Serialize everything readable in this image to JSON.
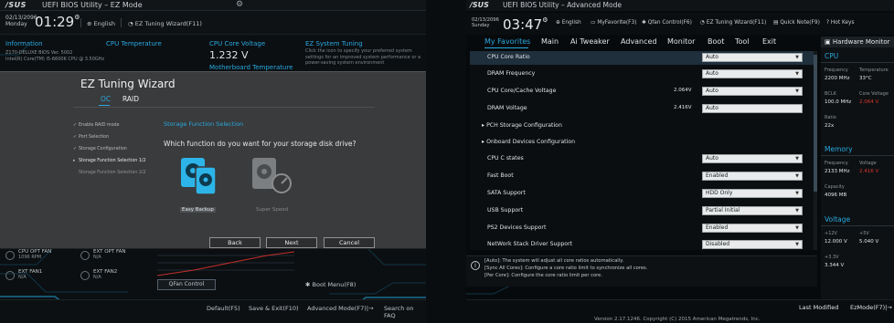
{
  "ez": {
    "logo": "/SUS",
    "title": "UEFI BIOS Utility – EZ Mode",
    "date": "02/13/2096",
    "day": "Monday",
    "time": "01:29",
    "language": "English",
    "wizard_link": "EZ Tuning Wizard(F11)",
    "info_head": "Information",
    "cpu_temp_head": "CPU Temperature",
    "cpu_volt_head": "CPU Core Voltage",
    "cpu_volt_value": "1.232 V",
    "ez_system_tuning_head": "EZ System Tuning",
    "ez_system_tuning_text": "Click the icon to specify your preferred system settings for an improved system performance or a power-saving system environment",
    "mb_temp_head": "Motherboard Temperature",
    "info_lines": [
      "Z170-DELUXE   BIOS Ver. 5002",
      "Intel(R) Core(TM) i5-6600K CPU @ 3.50GHz"
    ],
    "fans": [
      {
        "name": "CPU OPT FAN",
        "value": "1096 RPM"
      },
      {
        "name": "EXT FAN1",
        "value": "N/A"
      },
      {
        "name": "EXT OPT FAN",
        "value": "N/A"
      },
      {
        "name": "EXT FAN2",
        "value": "N/A"
      }
    ],
    "qfan_button": "QFan Control",
    "boot_menu": "Boot Menu(F8)",
    "bottom": [
      "Default(F5)",
      "Save & Exit(F10)",
      "Advanced Mode(F7)|→",
      "Search on FAQ"
    ]
  },
  "wizard": {
    "title": "EZ Tuning Wizard",
    "tabs": [
      "OC",
      "RAID"
    ],
    "steps": [
      "Enable RAID mode",
      "Port Selection",
      "Storage Configuration",
      "Storage Function Selection 1/2",
      "Storage Function Selection 2/2"
    ],
    "section_title": "Storage Function Selection",
    "question": "Which function do you want for your storage disk drive?",
    "options": [
      "Easy Backup",
      "Super Speed"
    ],
    "buttons": [
      "Back",
      "Next",
      "Cancel"
    ]
  },
  "adv": {
    "logo": "/SUS",
    "title": "UEFI BIOS Utility – Advanced Mode",
    "date": "02/13/2096",
    "day": "Sunday",
    "time": "03:47",
    "top_items": [
      "English",
      "MyFavorite(F3)",
      "Qfan Control(F6)",
      "EZ Tuning Wizard(F11)",
      "Quick Note(F9)",
      "Hot Keys"
    ],
    "menu": [
      "My Favorites",
      "Main",
      "Ai Tweaker",
      "Advanced",
      "Monitor",
      "Boot",
      "Tool",
      "Exit"
    ],
    "settings": [
      {
        "label": "CPU Core Ratio",
        "value": "Auto",
        "type": "select"
      },
      {
        "label": "DRAM Frequency",
        "value": "Auto",
        "type": "select"
      },
      {
        "label": "CPU Core/Cache Voltage",
        "voltage": "2.064V",
        "value": "Auto",
        "type": "select"
      },
      {
        "label": "DRAM Voltage",
        "voltage": "2.416V",
        "value": "Auto",
        "type": "input"
      },
      {
        "label": "▸ PCH Storage Configuration",
        "type": "submenu"
      },
      {
        "label": "▸ Onboard Devices Configuration",
        "type": "submenu"
      },
      {
        "label": "CPU C states",
        "value": "Auto",
        "type": "select"
      },
      {
        "label": "Fast Boot",
        "value": "Enabled",
        "type": "select"
      },
      {
        "label": "SATA Support",
        "value": "HDD Only",
        "type": "select"
      },
      {
        "label": "USB Support",
        "value": "Partial Initial",
        "type": "select"
      },
      {
        "label": "PS2 Devices Support",
        "value": "Enabled",
        "type": "select"
      },
      {
        "label": "NetWork Stack Driver Support",
        "value": "Disabled",
        "type": "select"
      }
    ],
    "info": [
      "[Auto]: The system will adjust all core ratios automatically.",
      "[Sync All Cores]: Configure a core ratio limit to synchronize all cores.",
      "[Per Core]: Configure the core ratio limit per core."
    ],
    "copyright": "Version 2.17.1246. Copyright (C) 2015 American Megatrends, Inc.",
    "bottom": [
      "Last Modified",
      "EzMode(F7)|→"
    ],
    "hw_monitor": {
      "title": "Hardware Monitor",
      "cpu": {
        "head": "CPU",
        "freq_lbl": "Frequency",
        "freq": "2200 MHz",
        "temp_lbl": "Temperature",
        "temp": "33°C",
        "bclk_lbl": "BCLK",
        "bclk": "100.0 MHz",
        "cv_lbl": "Core Voltage",
        "cv": "2.064 V",
        "ratio_lbl": "Ratio",
        "ratio": "22x"
      },
      "memory": {
        "head": "Memory",
        "freq_lbl": "Frequency",
        "freq": "2133 MHz",
        "volt_lbl": "Voltage",
        "volt": "2.416 V",
        "cap_lbl": "Capacity",
        "cap": "4096 MB"
      },
      "voltage": {
        "head": "Voltage",
        "v12_lbl": "+12V",
        "v12": "12.000 V",
        "v5_lbl": "+5V",
        "v5": "5.040 V",
        "v33_lbl": "+3.3V",
        "v33": "3.344 V"
      }
    }
  },
  "colors": {
    "accent": "#29a8df",
    "warning": "#d9362e",
    "selected_row": "#1f2f3c"
  }
}
